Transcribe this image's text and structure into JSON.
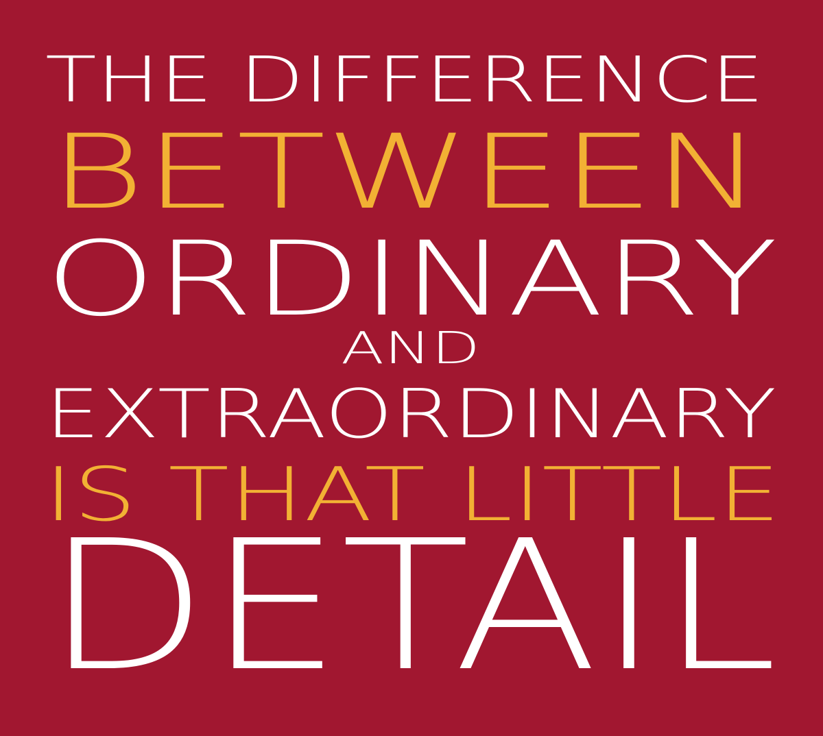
{
  "colors": {
    "background": "#a11730",
    "white": "#ffffff",
    "accent": "#f2b134"
  },
  "quote": {
    "lines": [
      {
        "text": "THE DIFFERENCE",
        "color": "white"
      },
      {
        "text": "BETWEEN",
        "color": "accent"
      },
      {
        "text": "ORDINARY",
        "color": "white"
      },
      {
        "text": "AND",
        "color": "white"
      },
      {
        "text": "EXTRAORDINARY",
        "color": "white"
      },
      {
        "text": "IS THAT LITTLE",
        "color": "accent"
      },
      {
        "text": "DETAIL",
        "color": "white"
      }
    ]
  }
}
